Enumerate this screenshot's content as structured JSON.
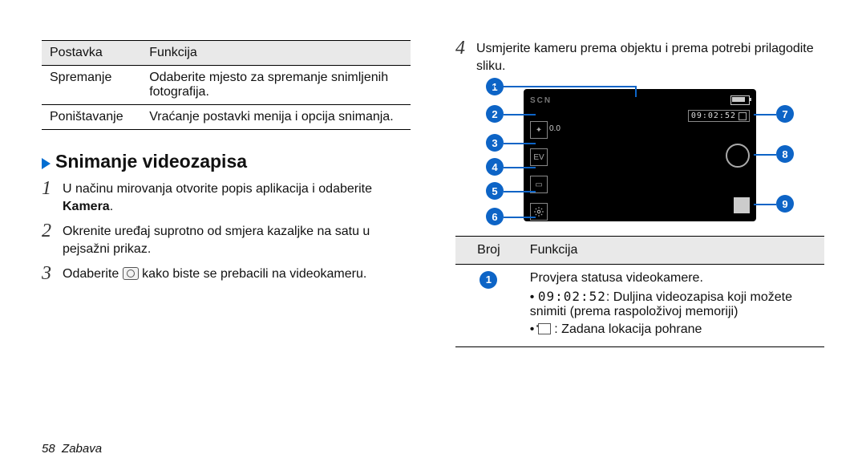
{
  "left_table": {
    "head": [
      "Postavka",
      "Funkcija"
    ],
    "rows": [
      {
        "c0": "Spremanje",
        "c1": "Odaberite mjesto za spremanje snimljenih fotografija."
      },
      {
        "c0": "Poništavanje",
        "c1": "Vraćanje postavki menija i opcija snimanja."
      }
    ]
  },
  "section_title": "Snimanje videozapisa",
  "steps": {
    "s1a": "U načinu mirovanja otvorite popis aplikacija i odaberite ",
    "s1b": "Kamera",
    "s1c": ".",
    "s2": "Okrenite uređaj suprotno od smjera kazaljke na satu u pejsažni prikaz.",
    "s3a": "Odaberite ",
    "s3b": " kako biste se prebacili na videokameru."
  },
  "step4a": "Usmjerite kameru prema objektu i prema potrebi prilagodite sliku.",
  "diagram": {
    "scn": "SCN",
    "time": "09:02:52",
    "ev": "0.0"
  },
  "right_table": {
    "head": [
      "Broj",
      "Funkcija"
    ],
    "row1": {
      "badge": "1",
      "title": "Provjera statusa videokamere.",
      "bullet1_time": "09:02:52",
      "bullet1_rest": ": Duljina videozapisa koji možete snimiti (prema raspoloživoj memoriji)",
      "bullet2_rest": " : Zadana lokacija pohrane"
    }
  },
  "footer": {
    "page": "58",
    "section": "Zabava"
  }
}
